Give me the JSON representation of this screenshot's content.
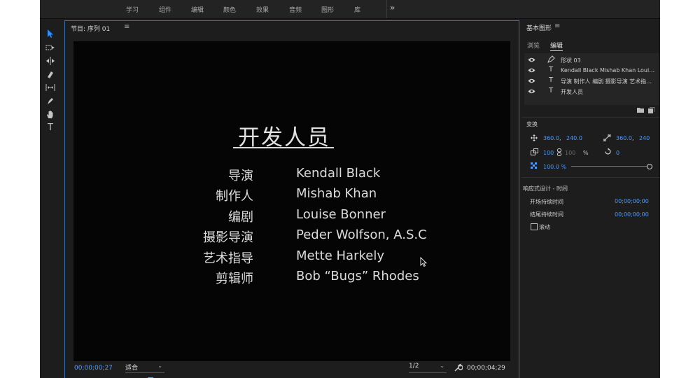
{
  "workspaces": [
    "学习",
    "组件",
    "编辑",
    "颜色",
    "效果",
    "音频",
    "图形",
    "库"
  ],
  "workspaces_more": "»",
  "program_monitor": {
    "title": "节目: 序列 01",
    "menu_glyph": "≡",
    "credits_title": "开发人员",
    "credits": [
      {
        "role": "导演",
        "name": "Kendall Black"
      },
      {
        "role": "制作人",
        "name": "Mishab Khan"
      },
      {
        "role": "编剧",
        "name": "Louise Bonner"
      },
      {
        "role": "摄影导演",
        "name": "Peder Wolfson, A.S.C"
      },
      {
        "role": "艺术指导",
        "name": "Mette Harkely"
      },
      {
        "role": "剪辑师",
        "name": "Bob “Bugs” Rhodes"
      }
    ],
    "current_timecode": "00;00;00;27",
    "fit_label": "适合",
    "resolution_label": "1/2",
    "duration_timecode": "00;00;04;29"
  },
  "essential_graphics": {
    "title": "基本图形",
    "menu_glyph": "≡",
    "tabs": [
      {
        "label": "浏览",
        "active": false
      },
      {
        "label": "编辑",
        "active": true
      }
    ],
    "layers": [
      {
        "type_icon": "pen-icon",
        "name": "形状 03"
      },
      {
        "type_icon": "text-icon",
        "name": "Kendall Black Mishab Khan Louise Bonner Peder Wolfson, A.S.C Mette Harkely Bob Rhodes"
      },
      {
        "type_icon": "text-icon",
        "name": "导演 制作人 编剧 摄影导演 艺术指导 剪辑师"
      },
      {
        "type_icon": "text-icon",
        "name": "开发人员"
      }
    ],
    "transform": {
      "label": "变换",
      "position_x": "360.0",
      "position_y": "240.0",
      "anchor_x": "360.0",
      "anchor_y": "240",
      "scale": "100",
      "scale_linked": "100",
      "percent": "%",
      "rotation": "0",
      "opacity": "100.0 %"
    },
    "responsive": {
      "label": "响应式设计 - 时间",
      "intro_label": "开场持续时间",
      "intro_value": "00;00;00;00",
      "outro_label": "结尾持续时间",
      "outro_value": "00;00;00;00",
      "roll_label": "滚动"
    }
  },
  "colors": {
    "accent_blue": "#4f9cff",
    "panel_bg": "#1d1d1d",
    "video_bg": "#050505"
  }
}
